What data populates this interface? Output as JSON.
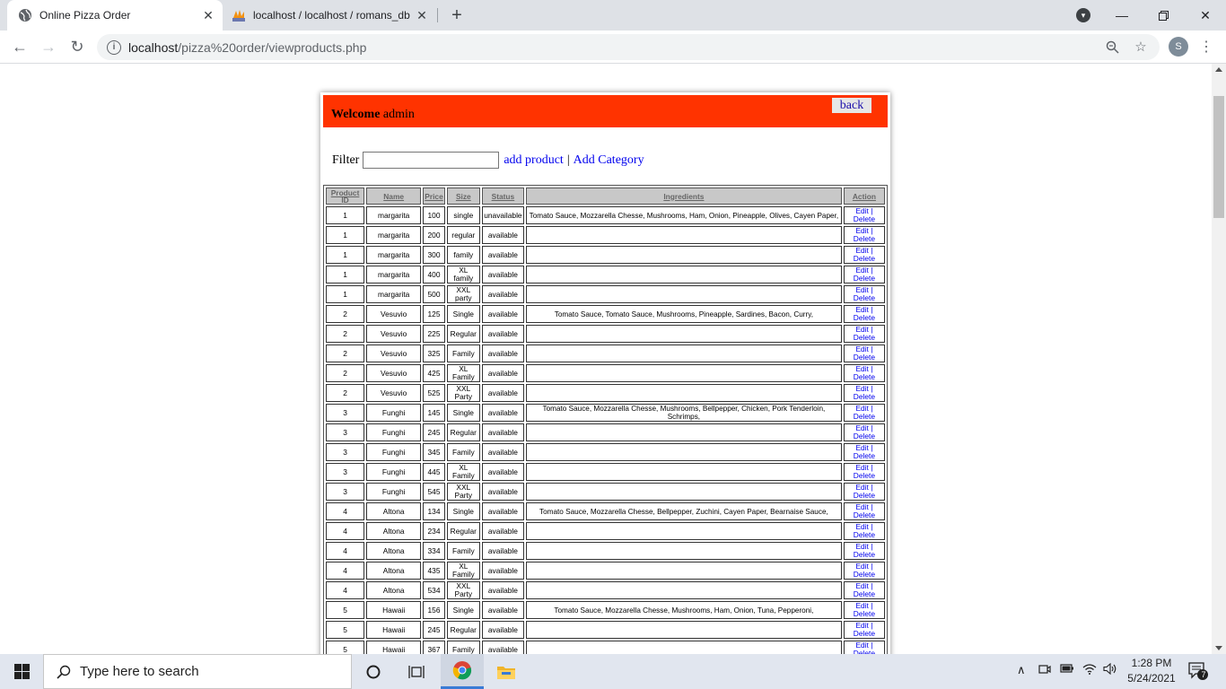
{
  "browser": {
    "tabs": [
      {
        "title": "Online Pizza Order",
        "active": true
      },
      {
        "title": "localhost / localhost / romans_db",
        "active": false
      }
    ],
    "url_host": "localhost",
    "url_path": "/pizza%20order/viewproducts.php",
    "avatar_letter": "S"
  },
  "page": {
    "welcome_bold": "Welcome",
    "welcome_user": " admin",
    "back_label": "back",
    "filter_label": "Filter",
    "filter_value": "",
    "add_product_label": "add product",
    "link_separator": "|",
    "add_category_label": "Add Category",
    "columns": [
      "Product ID",
      "Name",
      "Price",
      "Size",
      "Status",
      "Ingredients",
      "Action"
    ],
    "edit_label": "Edit |",
    "delete_label": "Delete",
    "rows": [
      {
        "id": "1",
        "name": "margarita",
        "price": "100",
        "size": "single",
        "status": "unavailable",
        "ingredients": "Tomato Sauce, Mozzarella Chesse, Mushrooms, Ham, Onion, Pineapple, Olives, Cayen Paper,"
      },
      {
        "id": "1",
        "name": "margarita",
        "price": "200",
        "size": "regular",
        "status": "available",
        "ingredients": ""
      },
      {
        "id": "1",
        "name": "margarita",
        "price": "300",
        "size": "family",
        "status": "available",
        "ingredients": ""
      },
      {
        "id": "1",
        "name": "margarita",
        "price": "400",
        "size": "XL family",
        "status": "available",
        "ingredients": ""
      },
      {
        "id": "1",
        "name": "margarita",
        "price": "500",
        "size": "XXL party",
        "status": "available",
        "ingredients": ""
      },
      {
        "id": "2",
        "name": "Vesuvio",
        "price": "125",
        "size": "Single",
        "status": "available",
        "ingredients": "Tomato Sauce, Tomato Sauce, Mushrooms, Pineapple, Sardines, Bacon, Curry,"
      },
      {
        "id": "2",
        "name": "Vesuvio",
        "price": "225",
        "size": "Regular",
        "status": "available",
        "ingredients": ""
      },
      {
        "id": "2",
        "name": "Vesuvio",
        "price": "325",
        "size": "Family",
        "status": "available",
        "ingredients": ""
      },
      {
        "id": "2",
        "name": "Vesuvio",
        "price": "425",
        "size": "XL Family",
        "status": "available",
        "ingredients": ""
      },
      {
        "id": "2",
        "name": "Vesuvio",
        "price": "525",
        "size": "XXL Party",
        "status": "available",
        "ingredients": ""
      },
      {
        "id": "3",
        "name": "Funghi",
        "price": "145",
        "size": "Single",
        "status": "available",
        "ingredients": "Tomato Sauce, Mozzarella Chesse, Mushrooms, Bellpepper, Chicken, Pork Tenderloin, Schrimps,"
      },
      {
        "id": "3",
        "name": "Funghi",
        "price": "245",
        "size": "Regular",
        "status": "available",
        "ingredients": ""
      },
      {
        "id": "3",
        "name": "Funghi",
        "price": "345",
        "size": "Family",
        "status": "available",
        "ingredients": ""
      },
      {
        "id": "3",
        "name": "Funghi",
        "price": "445",
        "size": "XL Family",
        "status": "available",
        "ingredients": ""
      },
      {
        "id": "3",
        "name": "Funghi",
        "price": "545",
        "size": "XXL Party",
        "status": "available",
        "ingredients": ""
      },
      {
        "id": "4",
        "name": "Altona",
        "price": "134",
        "size": "Single",
        "status": "available",
        "ingredients": "Tomato Sauce, Mozzarella Chesse, Bellpepper, Zuchini, Cayen Paper, Bearnaise Sauce,"
      },
      {
        "id": "4",
        "name": "Altona",
        "price": "234",
        "size": "Regular",
        "status": "available",
        "ingredients": ""
      },
      {
        "id": "4",
        "name": "Altona",
        "price": "334",
        "size": "Family",
        "status": "available",
        "ingredients": ""
      },
      {
        "id": "4",
        "name": "Altona",
        "price": "435",
        "size": "XL Family",
        "status": "available",
        "ingredients": ""
      },
      {
        "id": "4",
        "name": "Altona",
        "price": "534",
        "size": "XXL Party",
        "status": "available",
        "ingredients": ""
      },
      {
        "id": "5",
        "name": "Hawaii",
        "price": "156",
        "size": "Single",
        "status": "available",
        "ingredients": "Tomato Sauce, Mozzarella Chesse, Mushrooms, Ham, Onion, Tuna, Pepperoni,"
      },
      {
        "id": "5",
        "name": "Hawaii",
        "price": "245",
        "size": "Regular",
        "status": "available",
        "ingredients": ""
      },
      {
        "id": "5",
        "name": "Hawaii",
        "price": "367",
        "size": "Family",
        "status": "available",
        "ingredients": ""
      }
    ]
  },
  "taskbar": {
    "search_placeholder": "Type here to search",
    "time": "1:28 PM",
    "date": "5/24/2021",
    "notification_count": "7"
  }
}
